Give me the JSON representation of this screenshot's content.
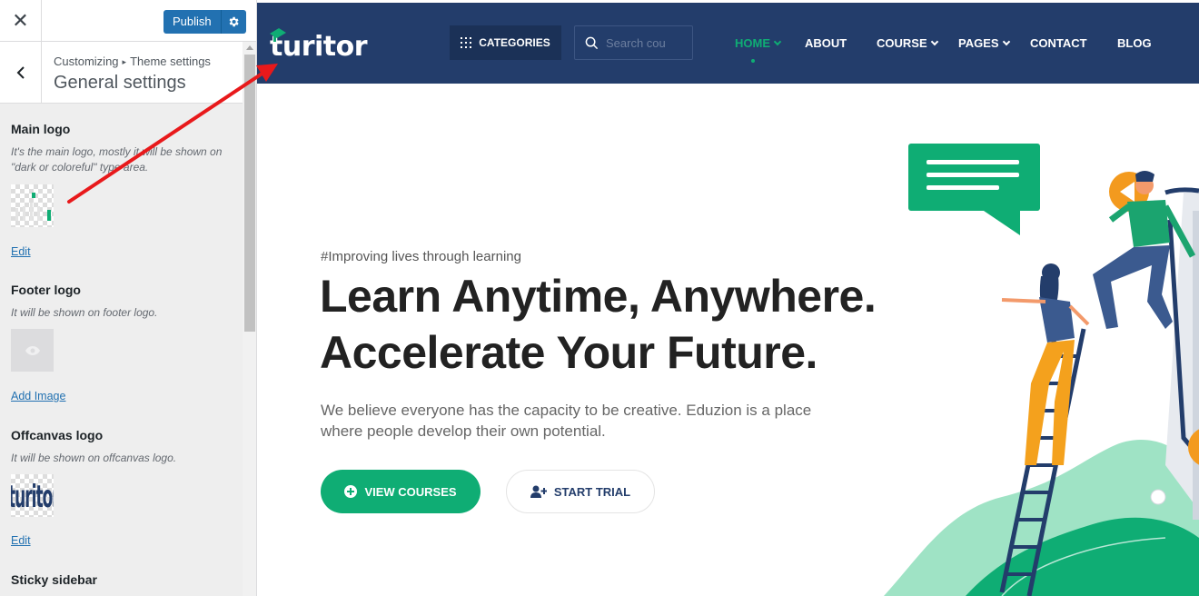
{
  "customizer": {
    "close_label": "✕",
    "publish_label": "Publish",
    "breadcrumb": {
      "root": "Customizing",
      "separator": "▸",
      "parent": "Theme settings"
    },
    "section_title": "General settings",
    "controls": {
      "main_logo": {
        "title": "Main logo",
        "description": "It's the main logo, mostly it will be shown on \"dark or coloreful\" type area.",
        "action": "Edit"
      },
      "footer_logo": {
        "title": "Footer logo",
        "description": "It will be shown on footer logo.",
        "action": "Add Image"
      },
      "offcanvas_logo": {
        "title": "Offcanvas logo",
        "description": "It will be shown on offcanvas logo.",
        "action": "Edit"
      },
      "sticky_sidebar": {
        "title": "Sticky sidebar"
      }
    }
  },
  "site": {
    "logo_text": "turitor",
    "categories_label": "CATEGORIES",
    "search_placeholder": "Search cou",
    "nav": [
      {
        "label": "HOME",
        "active": true,
        "dropdown": true
      },
      {
        "label": "ABOUT",
        "active": false,
        "dropdown": false
      },
      {
        "label": "COURSE",
        "active": false,
        "dropdown": true
      },
      {
        "label": "PAGES",
        "active": false,
        "dropdown": true
      },
      {
        "label": "CONTACT",
        "active": false,
        "dropdown": false
      },
      {
        "label": "BLOG",
        "active": false,
        "dropdown": false
      }
    ],
    "hero": {
      "tagline": "#Improving lives through learning",
      "headline_line1": "Learn Anytime, Anywhere.",
      "headline_line2": "Accelerate Your Future.",
      "paragraph": "We believe everyone has the capacity to be creative. Eduzion is a place where people develop their own potential.",
      "primary_button": "VIEW COURSES",
      "secondary_button": "START TRIAL"
    }
  },
  "colors": {
    "wp_blue": "#2271b1",
    "nav_bg": "#233d6b",
    "brand_green": "#0fad74",
    "annotation_red": "#e8191b"
  },
  "icons": [
    "close-icon",
    "gear-icon",
    "back-arrow-icon",
    "eye-icon",
    "grid-icon",
    "search-icon",
    "chevron-down-icon",
    "plus-circle-icon",
    "user-plus-icon"
  ]
}
